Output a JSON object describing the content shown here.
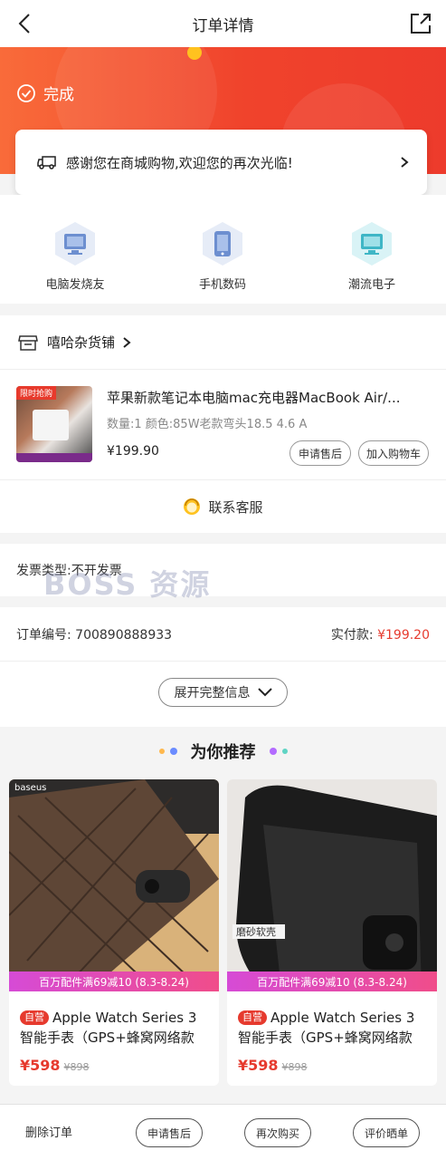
{
  "header": {
    "title": "订单详情",
    "back_icon": "back-chevron-icon",
    "share_icon": "share-icon"
  },
  "status": {
    "label": "完成"
  },
  "thanks": {
    "text": "感谢您在商城购物,欢迎您的再次光临!"
  },
  "categories": [
    {
      "label": "电脑发烧友",
      "icon": "monitor-icon"
    },
    {
      "label": "手机数码",
      "icon": "phone-icon"
    },
    {
      "label": "潮流电子",
      "icon": "monitor-icon"
    }
  ],
  "shop": {
    "name": "嘻哈杂货铺"
  },
  "item": {
    "badge": "限时抢购",
    "title": "苹果新款笔记本电脑mac充电器MacBook Air/...",
    "spec": "数量:1 颜色:85W老款弯头18.5 4.6 A",
    "price": "¥199.90",
    "after_sale": "申请售后",
    "add_cart": "加入购物车"
  },
  "service": {
    "label": "联系客服"
  },
  "invoice": {
    "text": "发票类型:不开发票"
  },
  "watermark": {
    "text": "BOSS 资源"
  },
  "order": {
    "number_label": "订单编号: 700890888933",
    "paid_label": "实付款: ",
    "paid_value": "¥199.20"
  },
  "expand": {
    "label": "展开完整信息"
  },
  "recommend": {
    "title": "为你推荐",
    "items": [
      {
        "promo": "百万配件满69减10 (8.3-8.24)",
        "self_tag": "自营",
        "name": "Apple Watch Series 3智能手表（GPS+蜂窝网络款 …",
        "price": "¥598",
        "orig": "¥898"
      },
      {
        "promo": "百万配件满69减10 (8.3-8.24)",
        "self_tag": "自营",
        "name": "Apple Watch Series 3智能手表（GPS+蜂窝网络款 …",
        "price": "¥598",
        "orig": "¥898"
      }
    ]
  },
  "bottom": {
    "delete": "删除订单",
    "after_sale": "申请售后",
    "rebuy": "再次购买",
    "review": "评价晒单"
  },
  "colors": {
    "accent": "#e63a2e",
    "banner": "#f0432c"
  }
}
